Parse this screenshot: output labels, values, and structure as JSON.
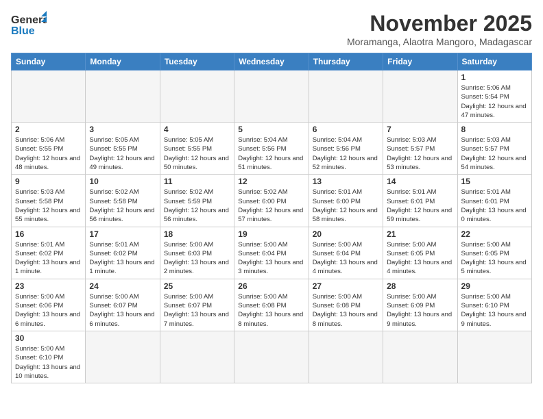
{
  "logo": {
    "line1": "General",
    "line2": "Blue"
  },
  "title": "November 2025",
  "location": "Moramanga, Alaotra Mangoro, Madagascar",
  "days_of_week": [
    "Sunday",
    "Monday",
    "Tuesday",
    "Wednesday",
    "Thursday",
    "Friday",
    "Saturday"
  ],
  "weeks": [
    [
      {
        "day": "",
        "info": ""
      },
      {
        "day": "",
        "info": ""
      },
      {
        "day": "",
        "info": ""
      },
      {
        "day": "",
        "info": ""
      },
      {
        "day": "",
        "info": ""
      },
      {
        "day": "",
        "info": ""
      },
      {
        "day": "1",
        "info": "Sunrise: 5:06 AM\nSunset: 5:54 PM\nDaylight: 12 hours\nand 47 minutes."
      }
    ],
    [
      {
        "day": "2",
        "info": "Sunrise: 5:06 AM\nSunset: 5:55 PM\nDaylight: 12 hours\nand 48 minutes."
      },
      {
        "day": "3",
        "info": "Sunrise: 5:05 AM\nSunset: 5:55 PM\nDaylight: 12 hours\nand 49 minutes."
      },
      {
        "day": "4",
        "info": "Sunrise: 5:05 AM\nSunset: 5:55 PM\nDaylight: 12 hours\nand 50 minutes."
      },
      {
        "day": "5",
        "info": "Sunrise: 5:04 AM\nSunset: 5:56 PM\nDaylight: 12 hours\nand 51 minutes."
      },
      {
        "day": "6",
        "info": "Sunrise: 5:04 AM\nSunset: 5:56 PM\nDaylight: 12 hours\nand 52 minutes."
      },
      {
        "day": "7",
        "info": "Sunrise: 5:03 AM\nSunset: 5:57 PM\nDaylight: 12 hours\nand 53 minutes."
      },
      {
        "day": "8",
        "info": "Sunrise: 5:03 AM\nSunset: 5:57 PM\nDaylight: 12 hours\nand 54 minutes."
      }
    ],
    [
      {
        "day": "9",
        "info": "Sunrise: 5:03 AM\nSunset: 5:58 PM\nDaylight: 12 hours\nand 55 minutes."
      },
      {
        "day": "10",
        "info": "Sunrise: 5:02 AM\nSunset: 5:58 PM\nDaylight: 12 hours\nand 56 minutes."
      },
      {
        "day": "11",
        "info": "Sunrise: 5:02 AM\nSunset: 5:59 PM\nDaylight: 12 hours\nand 56 minutes."
      },
      {
        "day": "12",
        "info": "Sunrise: 5:02 AM\nSunset: 6:00 PM\nDaylight: 12 hours\nand 57 minutes."
      },
      {
        "day": "13",
        "info": "Sunrise: 5:01 AM\nSunset: 6:00 PM\nDaylight: 12 hours\nand 58 minutes."
      },
      {
        "day": "14",
        "info": "Sunrise: 5:01 AM\nSunset: 6:01 PM\nDaylight: 12 hours\nand 59 minutes."
      },
      {
        "day": "15",
        "info": "Sunrise: 5:01 AM\nSunset: 6:01 PM\nDaylight: 13 hours\nand 0 minutes."
      }
    ],
    [
      {
        "day": "16",
        "info": "Sunrise: 5:01 AM\nSunset: 6:02 PM\nDaylight: 13 hours\nand 1 minute."
      },
      {
        "day": "17",
        "info": "Sunrise: 5:01 AM\nSunset: 6:02 PM\nDaylight: 13 hours\nand 1 minute."
      },
      {
        "day": "18",
        "info": "Sunrise: 5:00 AM\nSunset: 6:03 PM\nDaylight: 13 hours\nand 2 minutes."
      },
      {
        "day": "19",
        "info": "Sunrise: 5:00 AM\nSunset: 6:04 PM\nDaylight: 13 hours\nand 3 minutes."
      },
      {
        "day": "20",
        "info": "Sunrise: 5:00 AM\nSunset: 6:04 PM\nDaylight: 13 hours\nand 4 minutes."
      },
      {
        "day": "21",
        "info": "Sunrise: 5:00 AM\nSunset: 6:05 PM\nDaylight: 13 hours\nand 4 minutes."
      },
      {
        "day": "22",
        "info": "Sunrise: 5:00 AM\nSunset: 6:05 PM\nDaylight: 13 hours\nand 5 minutes."
      }
    ],
    [
      {
        "day": "23",
        "info": "Sunrise: 5:00 AM\nSunset: 6:06 PM\nDaylight: 13 hours\nand 6 minutes."
      },
      {
        "day": "24",
        "info": "Sunrise: 5:00 AM\nSunset: 6:07 PM\nDaylight: 13 hours\nand 6 minutes."
      },
      {
        "day": "25",
        "info": "Sunrise: 5:00 AM\nSunset: 6:07 PM\nDaylight: 13 hours\nand 7 minutes."
      },
      {
        "day": "26",
        "info": "Sunrise: 5:00 AM\nSunset: 6:08 PM\nDaylight: 13 hours\nand 8 minutes."
      },
      {
        "day": "27",
        "info": "Sunrise: 5:00 AM\nSunset: 6:08 PM\nDaylight: 13 hours\nand 8 minutes."
      },
      {
        "day": "28",
        "info": "Sunrise: 5:00 AM\nSunset: 6:09 PM\nDaylight: 13 hours\nand 9 minutes."
      },
      {
        "day": "29",
        "info": "Sunrise: 5:00 AM\nSunset: 6:10 PM\nDaylight: 13 hours\nand 9 minutes."
      }
    ],
    [
      {
        "day": "30",
        "info": "Sunrise: 5:00 AM\nSunset: 6:10 PM\nDaylight: 13 hours\nand 10 minutes."
      },
      {
        "day": "",
        "info": ""
      },
      {
        "day": "",
        "info": ""
      },
      {
        "day": "",
        "info": ""
      },
      {
        "day": "",
        "info": ""
      },
      {
        "day": "",
        "info": ""
      },
      {
        "day": "",
        "info": ""
      }
    ]
  ]
}
